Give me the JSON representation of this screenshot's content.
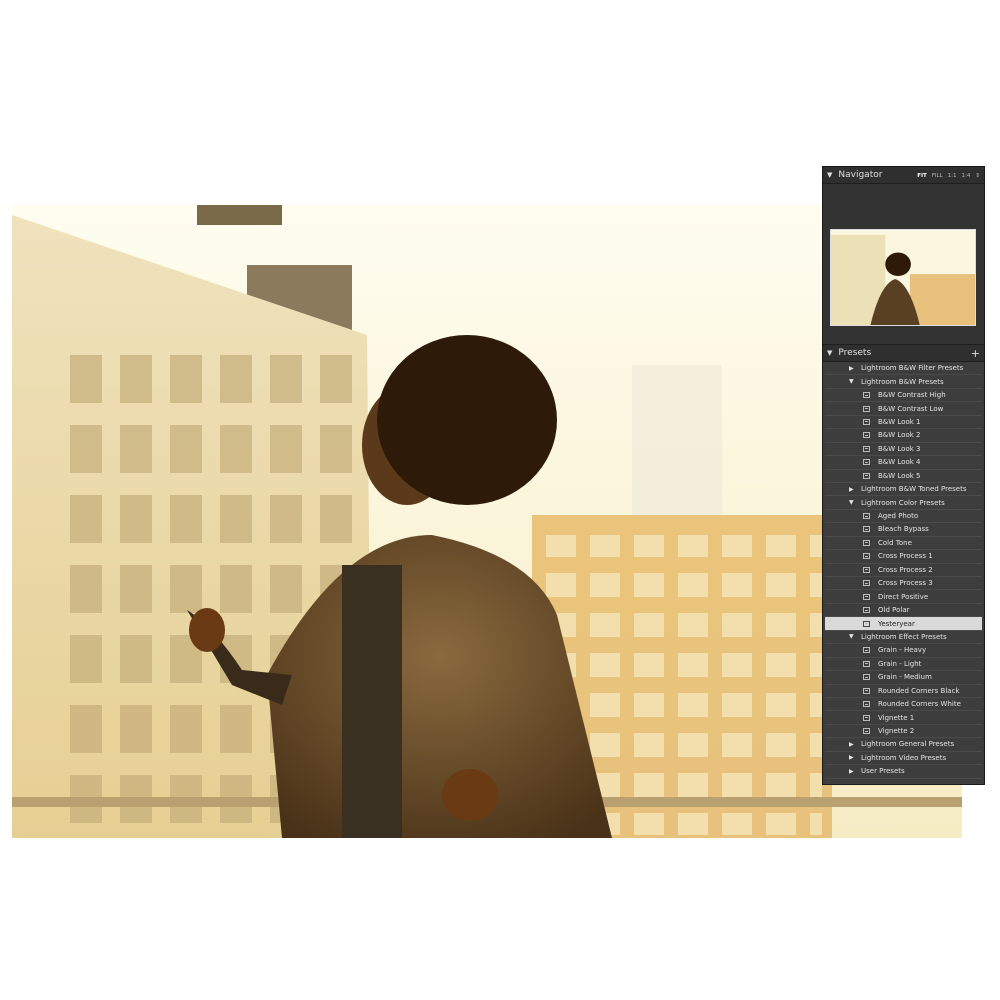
{
  "navigator": {
    "title": "Navigator",
    "zoom_options": [
      "FIT",
      "FILL",
      "1:1",
      "1:4"
    ],
    "active_zoom": "FIT"
  },
  "presets": {
    "title": "Presets",
    "add_icon": "plus-icon",
    "rows": [
      {
        "type": "folder",
        "label": "Lightroom B&W Filter Presets",
        "expanded": false
      },
      {
        "type": "folder",
        "label": "Lightroom B&W Presets",
        "expanded": true
      },
      {
        "type": "item",
        "label": "B&W Contrast High"
      },
      {
        "type": "item",
        "label": "B&W Contrast Low"
      },
      {
        "type": "item",
        "label": "B&W Look 1"
      },
      {
        "type": "item",
        "label": "B&W Look 2"
      },
      {
        "type": "item",
        "label": "B&W Look 3"
      },
      {
        "type": "item",
        "label": "B&W Look 4"
      },
      {
        "type": "item",
        "label": "B&W Look 5"
      },
      {
        "type": "folder",
        "label": "Lightroom B&W Toned Presets",
        "expanded": false
      },
      {
        "type": "folder",
        "label": "Lightroom Color Presets",
        "expanded": true
      },
      {
        "type": "item",
        "label": "Aged Photo"
      },
      {
        "type": "item",
        "label": "Bleach Bypass"
      },
      {
        "type": "item",
        "label": "Cold Tone"
      },
      {
        "type": "item",
        "label": "Cross Process 1"
      },
      {
        "type": "item",
        "label": "Cross Process 2"
      },
      {
        "type": "item",
        "label": "Cross Process 3"
      },
      {
        "type": "item",
        "label": "Direct Positive"
      },
      {
        "type": "item",
        "label": "Old Polar"
      },
      {
        "type": "item",
        "label": "Yesteryear",
        "selected": true
      },
      {
        "type": "folder",
        "label": "Lightroom Effect Presets",
        "expanded": true
      },
      {
        "type": "item",
        "label": "Grain - Heavy"
      },
      {
        "type": "item",
        "label": "Grain - Light"
      },
      {
        "type": "item",
        "label": "Grain - Medium"
      },
      {
        "type": "item",
        "label": "Rounded Corners Black"
      },
      {
        "type": "item",
        "label": "Rounded Corners White"
      },
      {
        "type": "item",
        "label": "Vignette 1"
      },
      {
        "type": "item",
        "label": "Vignette 2"
      },
      {
        "type": "folder",
        "label": "Lightroom General Presets",
        "expanded": false
      },
      {
        "type": "folder",
        "label": "Lightroom Video Presets",
        "expanded": false
      },
      {
        "type": "folder",
        "label": "User Presets",
        "expanded": false
      }
    ]
  },
  "colors": {
    "panel_bg": "#3d3d3d",
    "selected_row": "#d9d9d9",
    "photo_tone": "#e8c77a"
  }
}
